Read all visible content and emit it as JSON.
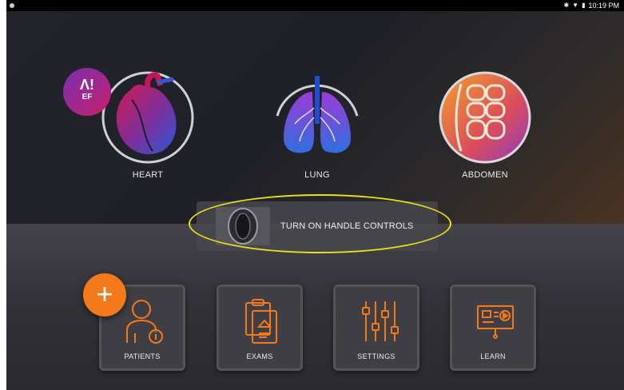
{
  "status_bar": {
    "time": "10:19 PM",
    "icons": [
      "bluetooth-icon",
      "wifi-icon",
      "battery-icon"
    ]
  },
  "exam_types": [
    {
      "label": "HEART"
    },
    {
      "label": "LUNG"
    },
    {
      "label": "ABDOMEN"
    }
  ],
  "ai_badge": {
    "label": "EF"
  },
  "handle_controls": {
    "label": "TURN ON HANDLE CONTROLS"
  },
  "tiles": [
    {
      "label": "PATIENTS"
    },
    {
      "label": "EXAMS"
    },
    {
      "label": "SETTINGS"
    },
    {
      "label": "LEARN"
    }
  ],
  "fab": {
    "label": "+"
  },
  "colors": {
    "accent": "#f27a1a",
    "highlight": "#e8e21a",
    "background": "#1b1c22"
  }
}
